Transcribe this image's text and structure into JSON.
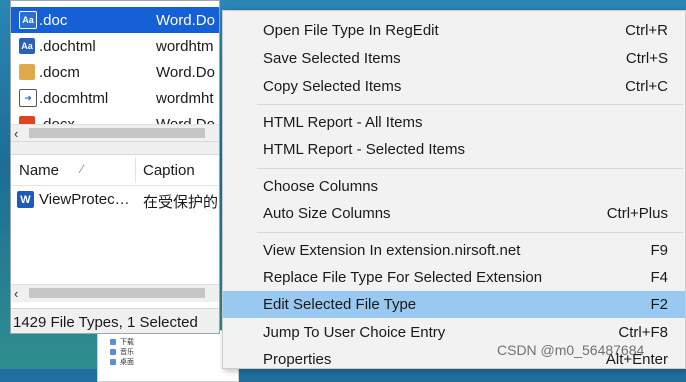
{
  "file_list": {
    "rows": [
      {
        "ext": ".doc",
        "caption": "Word.Do",
        "icon": "word-doc-icon",
        "selected": true
      },
      {
        "ext": ".dochtml",
        "caption": "wordhtm",
        "icon": "word-doc-icon",
        "selected": false
      },
      {
        "ext": ".docm",
        "caption": "Word.Do",
        "icon": "package-icon",
        "selected": false
      },
      {
        "ext": ".docmhtml",
        "caption": "wordmht",
        "icon": "document-arrow-icon",
        "selected": false
      },
      {
        "ext": ".docx",
        "caption": "Word.Do",
        "icon": "office-icon",
        "selected": false
      }
    ]
  },
  "lower_list": {
    "columns": {
      "name": "Name",
      "caption": "Caption",
      "sort_glyph": "⁄"
    },
    "rows": [
      {
        "name": "ViewProtec…",
        "caption": "在受保护的"
      }
    ]
  },
  "status_bar": {
    "text": "1429 File Types, 1 Selected"
  },
  "context_menu": {
    "items": [
      {
        "label": "Open File Type In RegEdit",
        "shortcut": "Ctrl+R"
      },
      {
        "label": "Save Selected Items",
        "shortcut": "Ctrl+S"
      },
      {
        "label": "Copy Selected Items",
        "shortcut": "Ctrl+C"
      },
      {
        "label": "HTML Report - All Items",
        "shortcut": ""
      },
      {
        "label": "HTML Report - Selected Items",
        "shortcut": ""
      },
      {
        "label": "Choose Columns",
        "shortcut": ""
      },
      {
        "label": "Auto Size Columns",
        "shortcut": "Ctrl+Plus"
      },
      {
        "label": "View Extension In extension.nirsoft.net",
        "shortcut": "F9"
      },
      {
        "label": "Replace File Type For Selected Extension",
        "shortcut": "F4"
      },
      {
        "label": "Edit Selected File Type",
        "shortcut": "F2",
        "highlighted": true
      },
      {
        "label": "Jump To User Choice Entry",
        "shortcut": "Ctrl+F8"
      },
      {
        "label": "Properties",
        "shortcut": "Alt+Enter"
      }
    ]
  },
  "background_explorer": {
    "items": [
      "下载",
      "音乐",
      "桌面"
    ]
  },
  "watermark": "CSDN @m0_56487684",
  "colors": {
    "selection": "#1560d6",
    "menu_highlight": "#99c9f1"
  }
}
